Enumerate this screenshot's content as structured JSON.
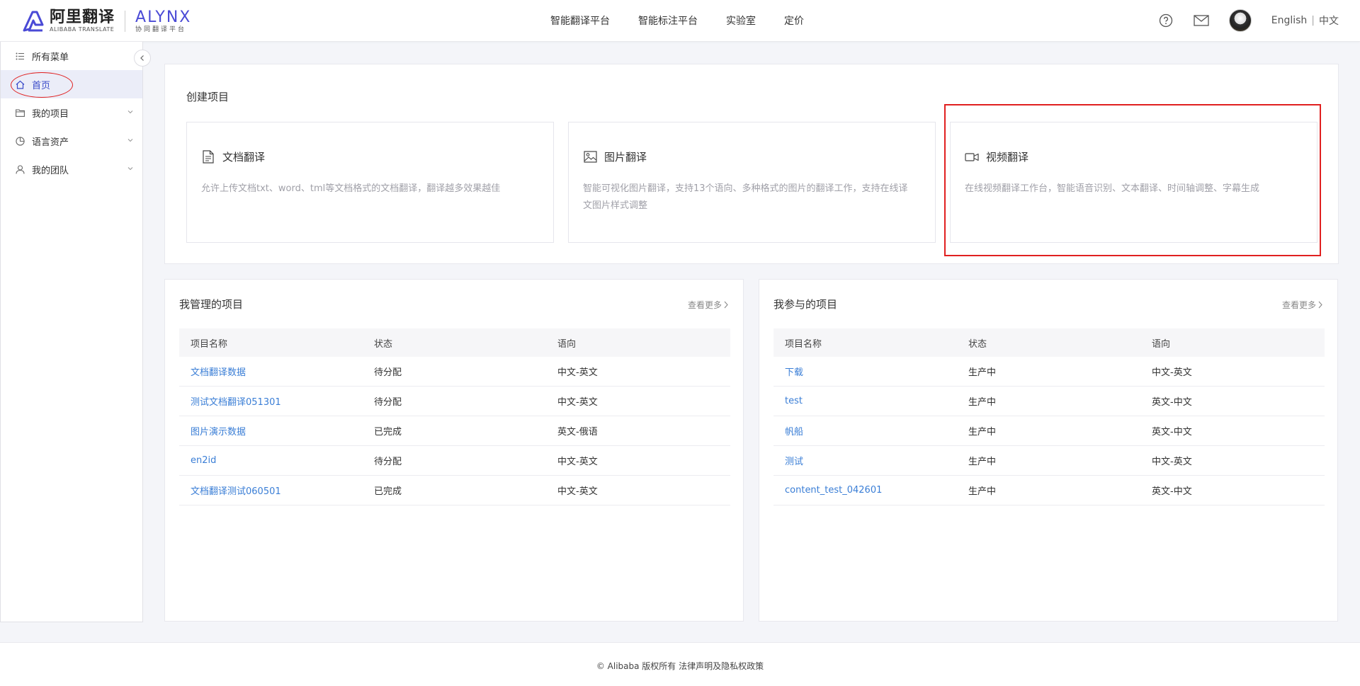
{
  "header": {
    "logo": {
      "cn": "阿里翻译",
      "en": "ALIBABA TRANSLATE"
    },
    "logo2": {
      "en": "ALYNX",
      "cn": "协同翻译平台"
    },
    "nav": [
      "智能翻译平台",
      "智能标注平台",
      "实验室",
      "定价"
    ],
    "lang_en": "English",
    "lang_sep": "|",
    "lang_cn": "中文"
  },
  "sidebar": {
    "items": [
      {
        "label": "所有菜单",
        "icon": "list-icon"
      },
      {
        "label": "首页",
        "icon": "home-icon"
      },
      {
        "label": "我的项目",
        "icon": "folder-icon"
      },
      {
        "label": "语言资产",
        "icon": "pie-chart-icon"
      },
      {
        "label": "我的团队",
        "icon": "user-icon"
      }
    ]
  },
  "create": {
    "title": "创建项目",
    "cards": [
      {
        "title": "文档翻译",
        "desc": "允许上传文档txt、word、tml等文档格式的文档翻译，翻译越多效果越佳",
        "icon": "document-icon"
      },
      {
        "title": "图片翻译",
        "desc": "智能可视化图片翻译，支持13个语向、多种格式的图片的翻译工作，支持在线译文图片样式调整",
        "icon": "image-icon"
      },
      {
        "title": "视频翻译",
        "desc": "在线视频翻译工作台，智能语音识别、文本翻译、时间轴调整、字幕生成",
        "icon": "video-icon"
      }
    ]
  },
  "managed": {
    "title": "我管理的项目",
    "more": "查看更多",
    "headers": [
      "项目名称",
      "状态",
      "语向"
    ],
    "rows": [
      [
        "文档翻译数据",
        "待分配",
        "中文-英文"
      ],
      [
        "测试文档翻译051301",
        "待分配",
        "中文-英文"
      ],
      [
        "图片演示数据",
        "已完成",
        "英文-俄语"
      ],
      [
        "en2id",
        "待分配",
        "中文-英文"
      ],
      [
        "文档翻译测试060501",
        "已完成",
        "中文-英文"
      ]
    ]
  },
  "joined": {
    "title": "我参与的项目",
    "more": "查看更多",
    "headers": [
      "项目名称",
      "状态",
      "语向"
    ],
    "rows": [
      [
        "下载",
        "生产中",
        "中文-英文"
      ],
      [
        "test",
        "生产中",
        "英文-中文"
      ],
      [
        "帆船",
        "生产中",
        "英文-中文"
      ],
      [
        "测试",
        "生产中",
        "中文-英文"
      ],
      [
        "content_test_042601",
        "生产中",
        "英文-中文"
      ]
    ]
  },
  "footer": {
    "text": "© Alibaba 版权所有 法律声明及隐私权政策"
  },
  "colors": {
    "accent": "#3a4bc9",
    "link": "#3a7ed6",
    "annotation": "#e02020"
  }
}
